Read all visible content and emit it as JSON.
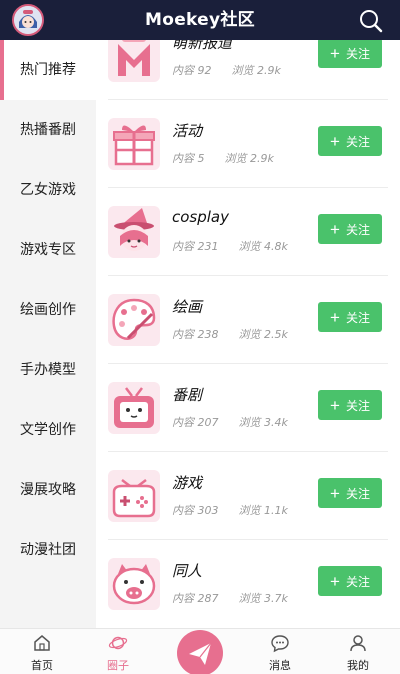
{
  "header": {
    "title": "Moekey社区"
  },
  "sidebar": {
    "items": [
      {
        "label": "热门推荐"
      },
      {
        "label": "热播番剧"
      },
      {
        "label": "乙女游戏"
      },
      {
        "label": "游戏专区"
      },
      {
        "label": "绘画创作"
      },
      {
        "label": "手办模型"
      },
      {
        "label": "文学创作"
      },
      {
        "label": "漫展攻略"
      },
      {
        "label": "动漫社团"
      }
    ]
  },
  "list": {
    "rows": [
      {
        "name": "萌新报道",
        "content_label": "内容",
        "content": "92",
        "views_label": "浏览",
        "views": "2.9k",
        "follow_label": "关注",
        "icon": "letter-m-icon"
      },
      {
        "name": "活动",
        "content_label": "内容",
        "content": "5",
        "views_label": "浏览",
        "views": "2.9k",
        "follow_label": "关注",
        "icon": "gift-box-icon"
      },
      {
        "name": "cosplay",
        "content_label": "内容",
        "content": "231",
        "views_label": "浏览",
        "views": "4.8k",
        "follow_label": "关注",
        "icon": "witch-girl-icon"
      },
      {
        "name": "绘画",
        "content_label": "内容",
        "content": "238",
        "views_label": "浏览",
        "views": "2.5k",
        "follow_label": "关注",
        "icon": "paint-palette-icon"
      },
      {
        "name": "番剧",
        "content_label": "内容",
        "content": "207",
        "views_label": "浏览",
        "views": "3.4k",
        "follow_label": "关注",
        "icon": "tv-icon"
      },
      {
        "name": "游戏",
        "content_label": "内容",
        "content": "303",
        "views_label": "浏览",
        "views": "1.1k",
        "follow_label": "关注",
        "icon": "gamepad-icon"
      },
      {
        "name": "同人",
        "content_label": "内容",
        "content": "287",
        "views_label": "浏览",
        "views": "3.7k",
        "follow_label": "关注",
        "icon": "cute-pig-icon"
      }
    ]
  },
  "bottom_nav": {
    "home": "首页",
    "circle": "圈子",
    "messages": "消息",
    "mine": "我的"
  },
  "colors": {
    "accent": "#e76f8f",
    "follow": "#4ac26b",
    "header": "#1a1f3a"
  }
}
